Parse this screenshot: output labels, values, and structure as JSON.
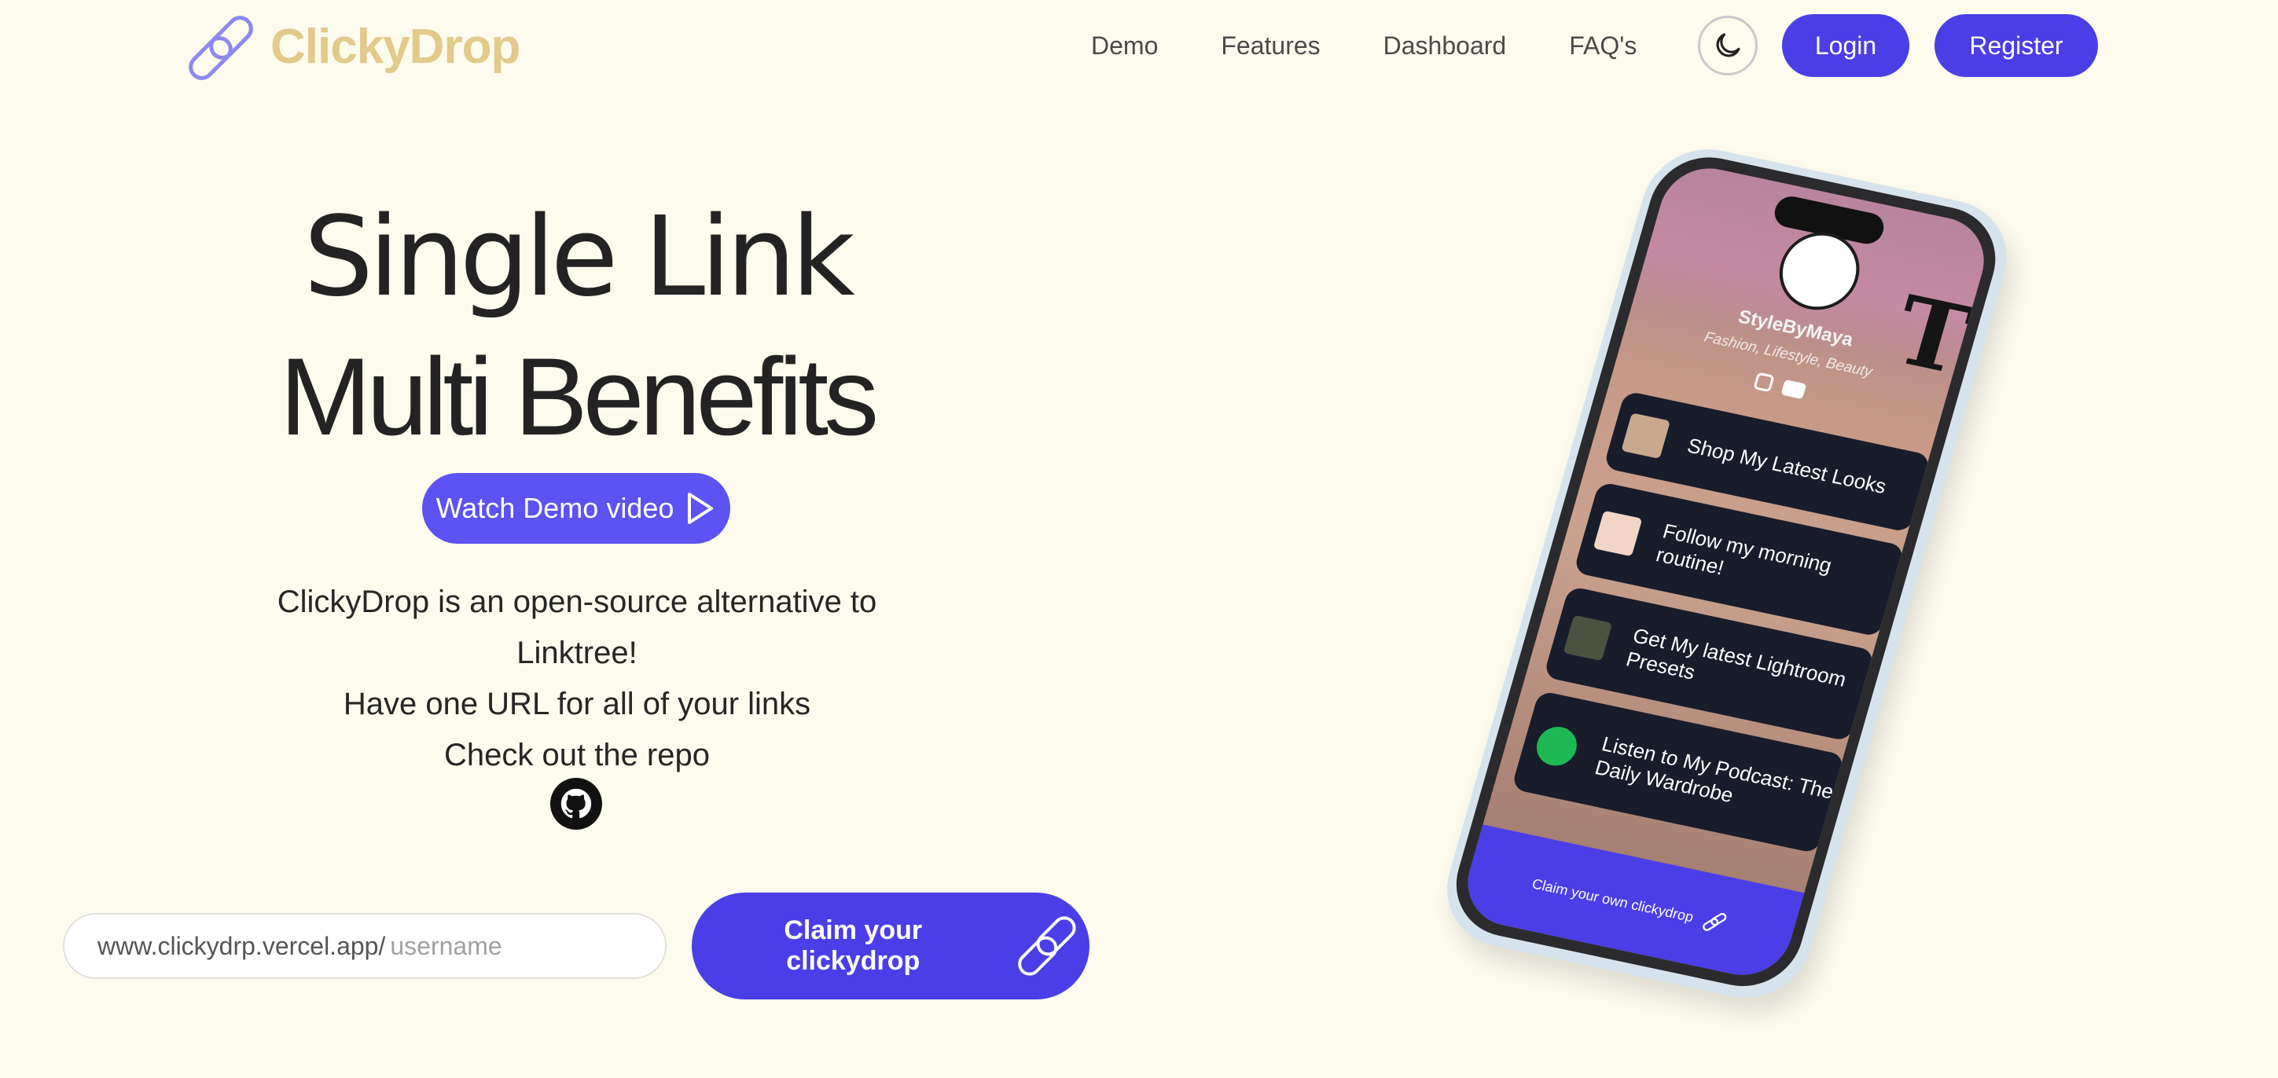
{
  "brand": {
    "name": "ClickyDrop",
    "color": "#e3c98a",
    "accent": "#4b3ee6"
  },
  "nav": {
    "links": [
      "Demo",
      "Features",
      "Dashboard",
      "FAQ's"
    ],
    "login": "Login",
    "register": "Register",
    "theme_icon": "moon-icon"
  },
  "hero": {
    "title_line1": "Single Link",
    "title_line2": "Multi Benefits",
    "demo_button": "Watch Demo video",
    "desc_line1": "ClickyDrop is an open-source alternative to",
    "desc_line2": "Linktree!",
    "desc_line3": "Have one URL for all of your links",
    "desc_line4": "Check out the repo",
    "github_icon": "github-icon"
  },
  "claim": {
    "prefix": "www.clickydrp.vercel.app/",
    "placeholder": "username",
    "button": "Claim your clickydrop"
  },
  "phone": {
    "name": "StyleByMaya",
    "tagline": "Fashion, Lifestyle, Beauty",
    "links": [
      {
        "label": "Shop My Latest Looks"
      },
      {
        "label": "Follow my morning routine!"
      },
      {
        "label": "Get My latest Lightroom Presets"
      },
      {
        "label": "Listen to My Podcast: The Daily Wardrobe"
      }
    ],
    "footer": "Claim your own clickydrop"
  }
}
